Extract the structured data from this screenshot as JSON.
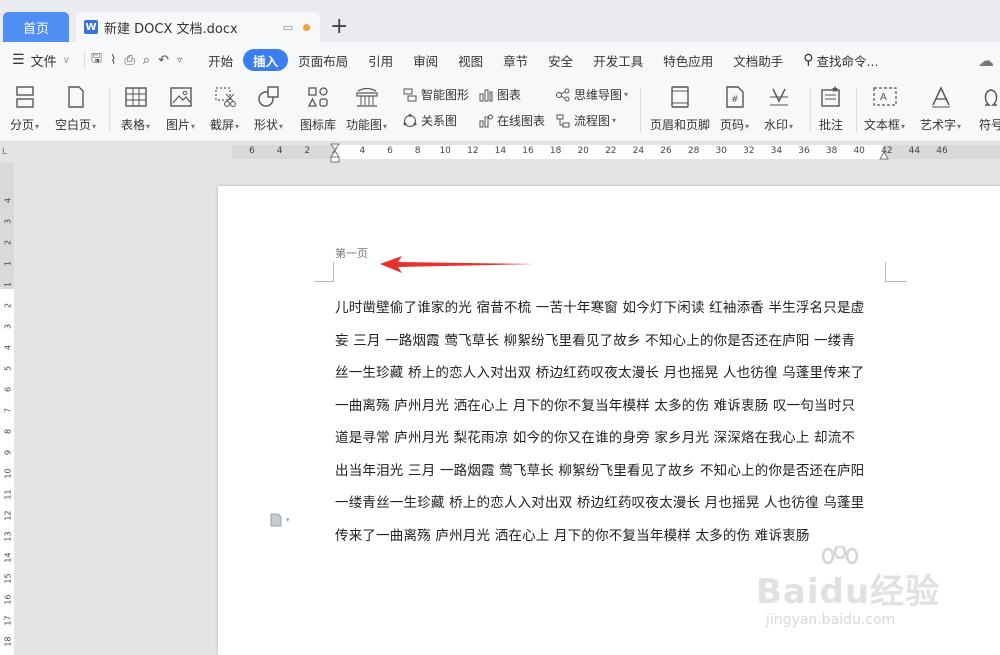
{
  "tabs": {
    "home_label": "首页",
    "doc_logo": "W",
    "doc_title": "新建 DOCX 文档.docx",
    "add": "+"
  },
  "menu": {
    "file_label": "文件",
    "items": [
      "开始",
      "插入",
      "页面布局",
      "引用",
      "审阅",
      "视图",
      "章节",
      "安全",
      "开发工具",
      "特色应用",
      "文档助手"
    ],
    "active": "插入",
    "search_label": "查找命令..."
  },
  "ribbon": {
    "page_break": "分页",
    "blank_page": "空白页",
    "table": "表格",
    "picture": "图片",
    "screenshot": "截屏",
    "shape": "形状",
    "icon_lib": "图标库",
    "func_chart": "功能图",
    "smart_shape": "智能图形",
    "chart": "图表",
    "mind_map": "思维导图",
    "relation_chart": "关系图",
    "online_chart": "在线图表",
    "flowchart": "流程图",
    "header_footer": "页眉和页脚",
    "page_number": "页码",
    "watermark": "水印",
    "comment": "批注",
    "text_box": "文本框",
    "word_art": "艺术字",
    "symbol": "符号"
  },
  "ruler": {
    "h_ticks": [
      "6",
      "4",
      "2",
      "2",
      "4",
      "6",
      "8",
      "10",
      "12",
      "14",
      "16",
      "18",
      "20",
      "22",
      "24",
      "26",
      "28",
      "30",
      "32",
      "34",
      "36",
      "38",
      "40",
      "42",
      "44",
      "46"
    ],
    "v_ticks": [
      "4",
      "3",
      "2",
      "1",
      "1",
      "2",
      "3",
      "4",
      "5",
      "6",
      "7",
      "8",
      "9",
      "10",
      "11",
      "12",
      "13",
      "14",
      "15",
      "16",
      "17",
      "18"
    ],
    "corner": "L"
  },
  "document": {
    "header_text": "第一页",
    "lines": [
      "儿时凿壁偷了谁家的光  宿昔不梳  一苦十年寒窗  如今灯下闲读  红袖添香  半生浮名只是虚",
      "妄  三月  一路烟霞  莺飞草长  柳絮纷飞里看见了故乡  不知心上的你是否还在庐阳  一缕青",
      "丝一生珍藏  桥上的恋人入对出双  桥边红药叹夜太漫长  月也摇晃  人也彷徨  乌蓬里传来了",
      "一曲离殇  庐州月光  洒在心上  月下的你不复当年模样  太多的伤  难诉衷肠  叹一句当时只",
      "道是寻常  庐州月光  梨花雨凉  如今的你又在谁的身旁  家乡月光  深深烙在我心上  却流不",
      "出当年泪光  三月  一路烟霞  莺飞草长  柳絮纷飞里看见了故乡  不知心上的你是否还在庐阳",
      "一缕青丝一生珍藏  桥上的恋人入对出双  桥边红药叹夜太漫长  月也摇晃  人也彷徨  乌蓬里",
      "传来了一曲离殇  庐州月光  洒在心上  月下的你不复当年模样  太多的伤  难诉衷肠"
    ]
  },
  "watermark": {
    "main": "Baidu经验",
    "sub": "jingyan.baidu.com"
  },
  "colors": {
    "accent": "#3b7ef2",
    "arrow": "#e8312f"
  }
}
